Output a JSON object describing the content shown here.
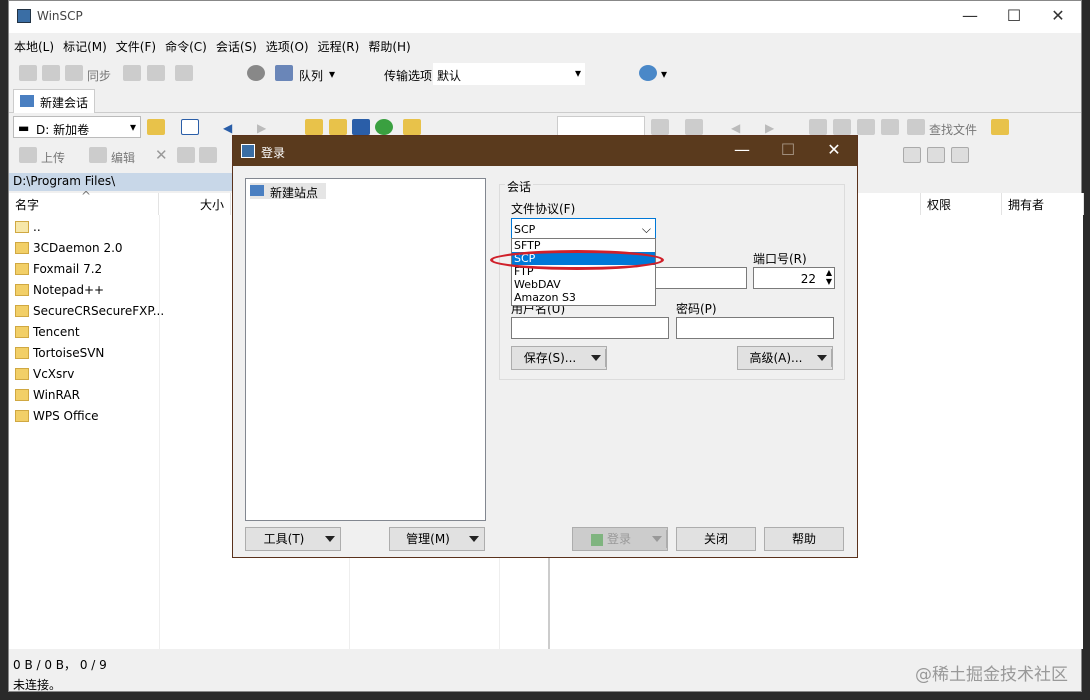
{
  "window": {
    "title": "WinSCP",
    "min": "—",
    "max": "☐",
    "close": "✕"
  },
  "menu": [
    "本地(L)",
    "标记(M)",
    "文件(F)",
    "命令(C)",
    "会话(S)",
    "选项(O)",
    "远程(R)",
    "帮助(H)"
  ],
  "toolbar": {
    "sync_label": "同步",
    "queue_label": "队列",
    "transfer_label": "传输选项",
    "transfer_value": "默认"
  },
  "session_tab": "新建会话",
  "local": {
    "drive": "D: 新加卷",
    "path": "D:\\Program Files\\",
    "upload": "上传",
    "edit": "编辑",
    "columns": {
      "name": "名字",
      "size": "大小"
    },
    "items": [
      "..",
      "3CDaemon 2.0",
      "Foxmail 7.2",
      "Notepad++",
      "SecureCRSecureFXP...",
      "Tencent",
      "TortoiseSVN",
      "VcXsrv",
      "WinRAR",
      "WPS Office"
    ]
  },
  "remote": {
    "find_files": "查找文件",
    "columns": {
      "perms": "权限",
      "owner": "拥有者"
    }
  },
  "status": {
    "bytes": "0 B / 0 B， 0 / 9",
    "conn": "未连接。"
  },
  "dialog": {
    "title": "登录",
    "tree_item": "新建站点",
    "session_group": "会话",
    "protocol_label": "文件协议(F)",
    "protocol_value": "SCP",
    "protocol_options": [
      "SFTP",
      "SCP",
      "FTP",
      "WebDAV",
      "Amazon S3"
    ],
    "selected_option": "SCP",
    "port_label": "端口号(R)",
    "port_value": "22",
    "user_label": "用户名(U)",
    "pass_label": "密码(P)",
    "save_btn": "保存(S)...",
    "advanced_btn": "高级(A)...",
    "tools_btn": "工具(T)",
    "manage_btn": "管理(M)",
    "login_btn": "登录",
    "close_btn": "关闭",
    "help_btn": "帮助"
  },
  "watermark": "@稀土掘金技术社区"
}
